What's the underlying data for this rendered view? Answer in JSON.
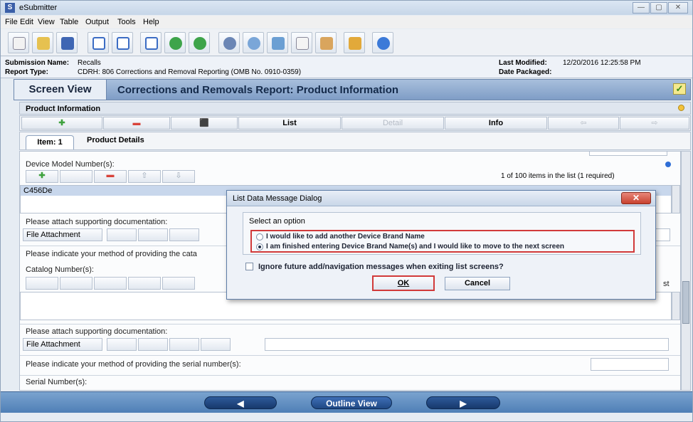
{
  "window": {
    "title": "eSubmitter",
    "logo_text": "S",
    "controls": [
      "—",
      "▢",
      "✕"
    ]
  },
  "menu": [
    "File",
    "Edit",
    "View",
    "Table",
    "Output",
    "Tools",
    "Help"
  ],
  "submission": {
    "name_label": "Submission Name:",
    "name_value": "Recalls",
    "type_label": "Report Type:",
    "type_value": "CDRH: 806 Corrections and Removal Reporting (OMB No. 0910-0359)",
    "modified_label": "Last Modified:",
    "modified_value": "12/20/2016 12:25:58 PM",
    "packaged_label": "Date Packaged:",
    "packaged_value": ""
  },
  "screen": {
    "view_label": "Screen View",
    "title": "Corrections and Removals Report: Product Information",
    "check_icon": "✓"
  },
  "product_info": {
    "header": "Product Information",
    "buttons": [
      "✚",
      "▬",
      "⬛",
      "List",
      "Detail",
      "Info",
      "⇦",
      "⇨"
    ]
  },
  "item": {
    "tab": "Item: 1",
    "label": "Product Details"
  },
  "content": {
    "device_model_label": "Device Model Number(s):",
    "list_count": "1 of 100 items in the list (1 required)",
    "device_value": "C456De",
    "attach_label_1": "Please attach supporting documentation:",
    "file_attachment_1": "File Attachment",
    "catalog_method_label": "Please indicate your method of providing the cata",
    "catalog_label": "Catalog Number(s):",
    "catalog_right_stub": "st",
    "attach_label_2": "Please attach supporting documentation:",
    "file_attachment_2": "File Attachment",
    "serial_method_label": "Please indicate your method of providing the serial number(s):",
    "serial_label": "Serial Number(s):"
  },
  "footer": {
    "back": "◀",
    "outline": "Outline View",
    "next": "▶"
  },
  "dialog": {
    "title": "List Data Message Dialog",
    "close": "✕",
    "group_label": "Select an option",
    "option1": "I would like to add another Device Brand Name",
    "option2": "I am finished entering Device Brand Name(s) and I would like to move to the next screen",
    "selected": "option2",
    "ignore_label": "Ignore future add/navigation messages when exiting list screens?",
    "ok": "OK",
    "cancel": "Cancel"
  }
}
